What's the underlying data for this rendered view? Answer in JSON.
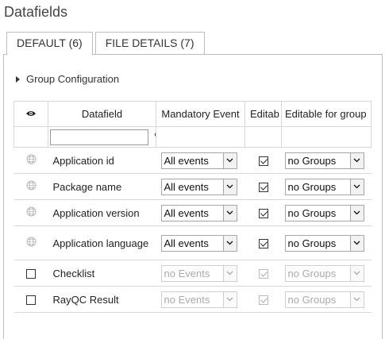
{
  "page": {
    "title": "Datafields"
  },
  "tabs": [
    {
      "label": "DEFAULT (6)",
      "active": true
    },
    {
      "label": "FILE DETAILS (7)",
      "active": false
    }
  ],
  "group_config": {
    "label": "Group Configuration"
  },
  "table": {
    "headers": {
      "visibility_icon": "eye-icon",
      "datafield": "Datafield",
      "mandatory_event": "Mandatory Event",
      "editable": "Editab",
      "editable_for_group": "Editable for group"
    },
    "filter": {
      "placeholder": "",
      "icon": "filter-icon"
    },
    "rows": [
      {
        "icon": "globe-icon",
        "name": "Application id",
        "event": "All events",
        "editable": true,
        "group": "no Groups",
        "disabled": false
      },
      {
        "icon": "globe-icon",
        "name": "Package name",
        "event": "All events",
        "editable": true,
        "group": "no Groups",
        "disabled": false
      },
      {
        "icon": "globe-icon",
        "name": "Application version",
        "event": "All events",
        "editable": true,
        "group": "no Groups",
        "disabled": false
      },
      {
        "icon": "globe-icon",
        "name": "Application language",
        "event": "All events",
        "editable": true,
        "group": "no Groups",
        "disabled": false
      },
      {
        "icon": "checkbox-icon",
        "name": "Checklist",
        "event": "no Events",
        "editable": true,
        "group": "no Groups",
        "disabled": true
      },
      {
        "icon": "checkbox-icon",
        "name": "RayQC Result",
        "event": "no Events",
        "editable": true,
        "group": "no Groups",
        "disabled": true
      }
    ]
  },
  "colors": {
    "border": "#bdbdbd",
    "text": "#222222",
    "disabled_text": "#aaaaaa"
  }
}
